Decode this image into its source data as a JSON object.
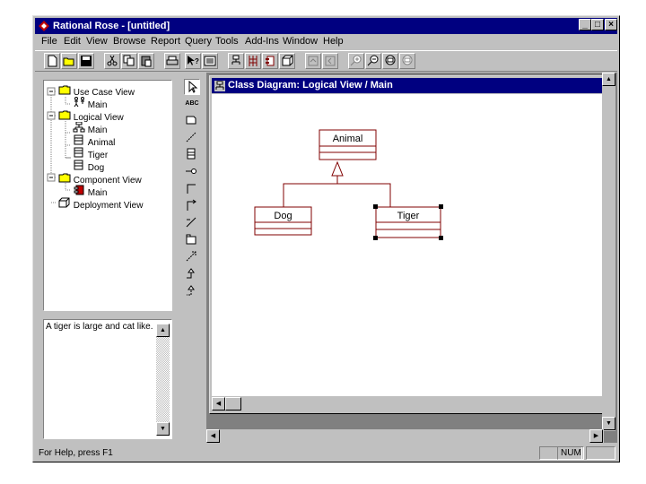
{
  "window": {
    "title": "Rational Rose - [untitled]",
    "controls": [
      "_",
      "□",
      "×"
    ]
  },
  "menu": [
    "File",
    "Edit",
    "View",
    "Browse",
    "Report",
    "Query",
    "Tools",
    "Add-Ins",
    "Window",
    "Help"
  ],
  "browser": {
    "items": [
      {
        "label": "Use Case View",
        "icon": "folder-icon"
      },
      {
        "label": "Main",
        "icon": "use-case-diagram-icon"
      },
      {
        "label": "Logical View",
        "icon": "folder-icon"
      },
      {
        "label": "Main",
        "icon": "class-diagram-icon"
      },
      {
        "label": "Animal",
        "icon": "class-icon"
      },
      {
        "label": "Tiger",
        "icon": "class-icon"
      },
      {
        "label": "Dog",
        "icon": "class-icon"
      },
      {
        "label": "Component View",
        "icon": "folder-icon"
      },
      {
        "label": "Main",
        "icon": "component-diagram-icon"
      },
      {
        "label": "Deployment View",
        "icon": "node-icon"
      }
    ]
  },
  "documentation": {
    "text": "A tiger is large and cat like."
  },
  "toolbox": {
    "text_tool_label": "ABC"
  },
  "diagram": {
    "title": "Class Diagram: Logical View / Main",
    "classes": {
      "animal": "Animal",
      "dog": "Dog",
      "tiger": "Tiger"
    },
    "selected": "Tiger",
    "relationship": "generalization"
  },
  "status": {
    "help": "For Help, press F1",
    "num": "NUM"
  },
  "colors": {
    "titlebar": "#000080",
    "chrome": "#c0c0c0",
    "class_border": "#800000"
  }
}
